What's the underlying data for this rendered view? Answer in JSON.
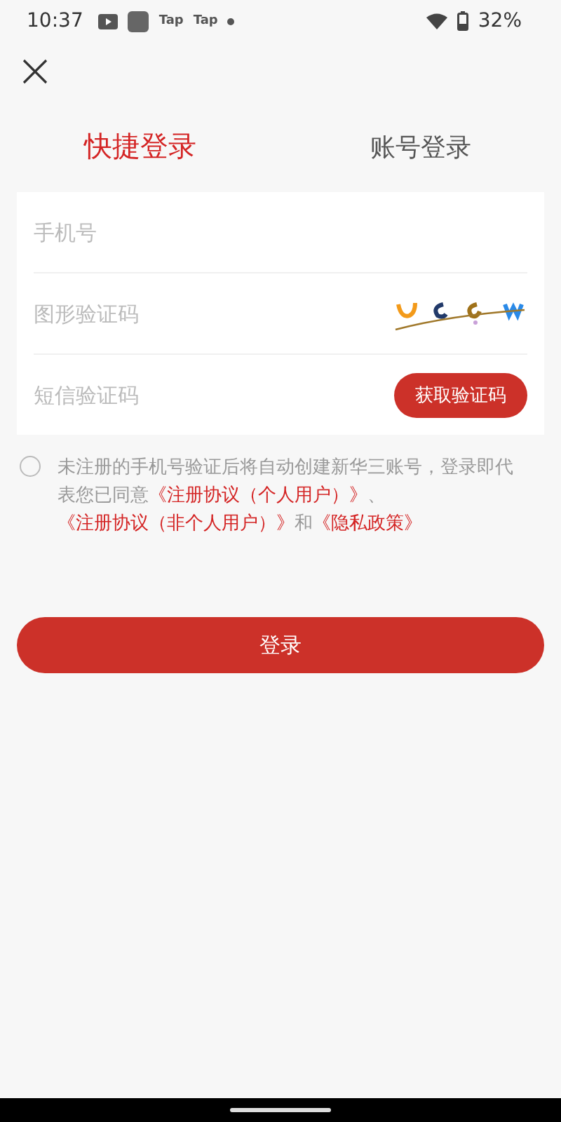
{
  "status_bar": {
    "time": "10:37",
    "app_labels": [
      "Tap",
      "Tap"
    ],
    "battery": "32%"
  },
  "tabs": [
    {
      "label": "快捷登录",
      "selected": true
    },
    {
      "label": "账号登录",
      "selected": false
    }
  ],
  "fields": [
    {
      "kind": "phone",
      "placeholder": "手机号"
    },
    {
      "kind": "captcha",
      "placeholder": "图形验证码"
    },
    {
      "kind": "sms",
      "placeholder": "短信验证码",
      "button": "获取验证码"
    }
  ],
  "agreement": {
    "checked": false,
    "segments": [
      {
        "text": "未注册的手机号验证后将自动创建新华三账号，登录即代表您已同意",
        "link": false
      },
      {
        "text": "《注册协议（个人用户）》",
        "link": true
      },
      {
        "text": "、",
        "link": false
      },
      {
        "text": "《注册协议（非个人用户）》",
        "link": true
      },
      {
        "text": "和",
        "link": false
      },
      {
        "text": "《隐私政策》",
        "link": true
      }
    ]
  },
  "login_button": "登录"
}
